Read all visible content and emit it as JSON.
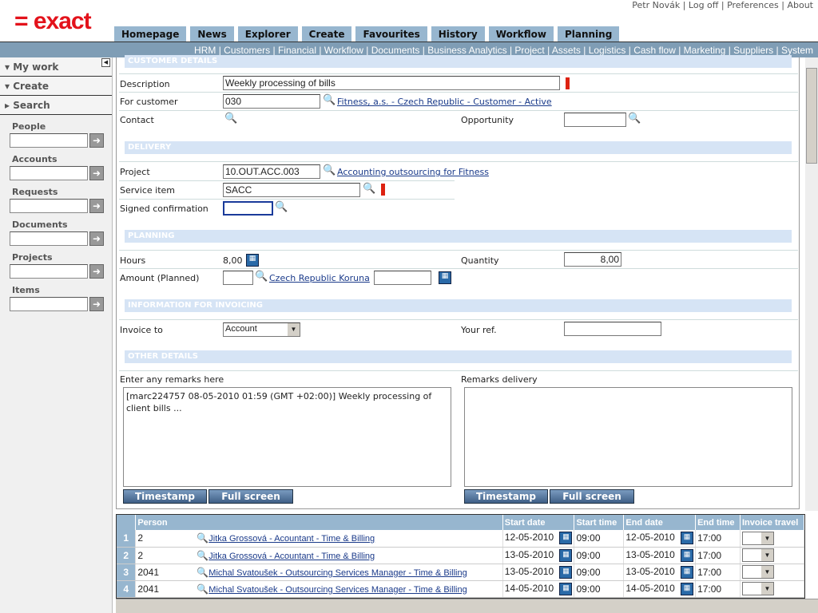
{
  "header": {
    "logo": "= exact",
    "user": "Petr Novák",
    "links": [
      "Log off",
      "Preferences",
      "About"
    ]
  },
  "tabs": [
    "Homepage",
    "News",
    "Explorer",
    "Create",
    "Favourites",
    "History",
    "Workflow",
    "Planning"
  ],
  "subnav": [
    "HRM",
    "Customers",
    "Financial",
    "Workflow",
    "Documents",
    "Business Analytics",
    "Project",
    "Assets",
    "Logistics",
    "Cash flow",
    "Marketing",
    "Suppliers",
    "System"
  ],
  "sidebar": {
    "sections": [
      "My work",
      "Create",
      "Search"
    ],
    "searches": [
      "People",
      "Accounts",
      "Requests",
      "Documents",
      "Projects",
      "Items"
    ]
  },
  "form": {
    "customer_details": "CUSTOMER DETAILS",
    "description_label": "Description",
    "description": "Weekly processing of bills",
    "customer_label": "For customer",
    "customer": "030",
    "customer_link": "Fitness, a.s. - Czech Republic - Customer - Active",
    "contact_label": "Contact",
    "opportunity_label": "Opportunity",
    "delivery": "DELIVERY",
    "project_label": "Project",
    "project": "10.OUT.ACC.003",
    "project_link": "Accounting outsourcing for Fitness",
    "service_label": "Service item",
    "service": "SACC",
    "signed_label": "Signed confirmation",
    "planning": "PLANNING",
    "hours_label": "Hours",
    "hours": "8,00",
    "quantity_label": "Quantity",
    "quantity": "8,00",
    "amount_label": "Amount (Planned)",
    "currency_link": "Czech Republic Koruna",
    "invoicing": "INFORMATION FOR INVOICING",
    "invoice_to_label": "Invoice to",
    "invoice_to": "Account",
    "your_ref_label": "Your ref.",
    "other": "OTHER DETAILS",
    "remarks_label": "Enter any remarks here",
    "remarks": "[marc224757 08-05-2010 01:59 (GMT +02:00)] Weekly processing of client bills ...",
    "remarks_delivery_label": "Remarks delivery",
    "timestamp": "Timestamp",
    "fullscreen": "Full screen"
  },
  "grid": {
    "columns": [
      "Person",
      "Start date",
      "Start time",
      "End date",
      "End time",
      "Invoice travel"
    ],
    "rows": [
      {
        "n": "1",
        "id": "2",
        "person": "Jitka Grossová - Acountant - Time & Billing",
        "start_date": "12-05-2010",
        "start_time": "09:00",
        "end_date": "12-05-2010",
        "end_time": "17:00"
      },
      {
        "n": "2",
        "id": "2",
        "person": "Jitka Grossová - Acountant - Time & Billing",
        "start_date": "13-05-2010",
        "start_time": "09:00",
        "end_date": "13-05-2010",
        "end_time": "17:00"
      },
      {
        "n": "3",
        "id": "2041",
        "person": "Michal Svatoušek - Outsourcing Services Manager - Time & Billing",
        "start_date": "13-05-2010",
        "start_time": "09:00",
        "end_date": "13-05-2010",
        "end_time": "17:00"
      },
      {
        "n": "4",
        "id": "2041",
        "person": "Michal Svatoušek - Outsourcing Services Manager - Time & Billing",
        "start_date": "14-05-2010",
        "start_time": "09:00",
        "end_date": "14-05-2010",
        "end_time": "17:00"
      }
    ]
  },
  "colors": {
    "brand": "#e3121b",
    "tab": "#97b6cf",
    "bar": "#7f9db5",
    "section": "#d6e4f5"
  }
}
